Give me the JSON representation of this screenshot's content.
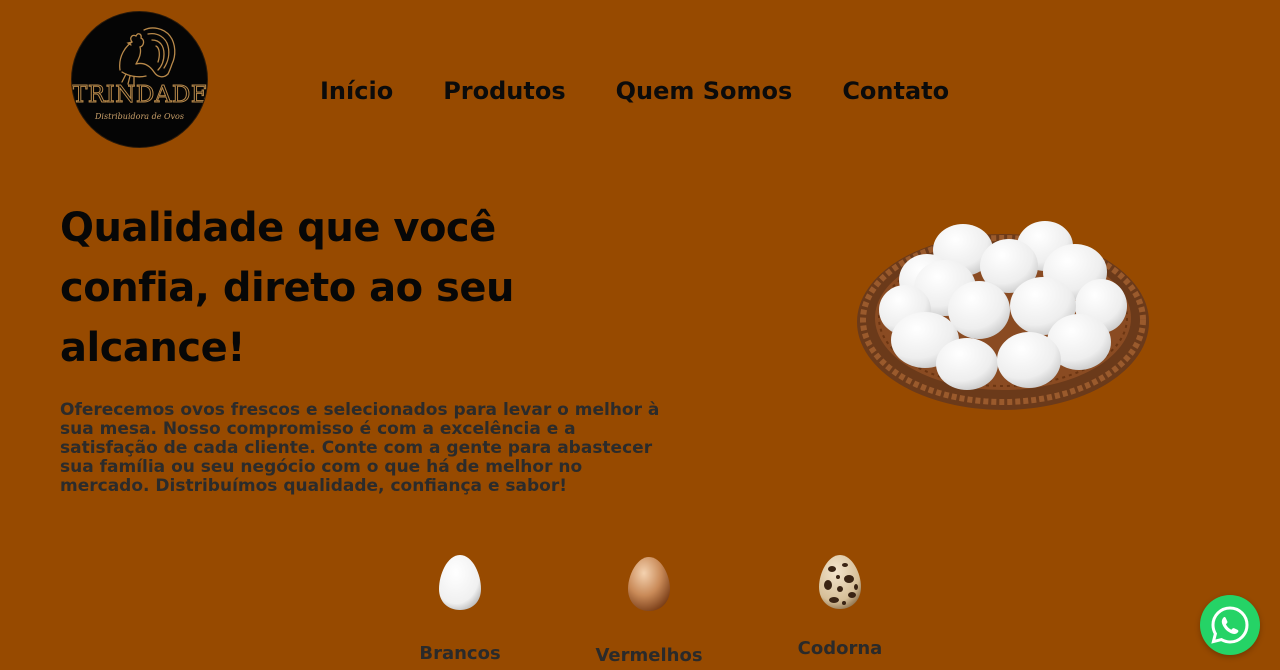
{
  "brand": {
    "name": "TRINDADE",
    "tagline": "Distribuidora de Ovos"
  },
  "nav": {
    "items": [
      {
        "label": "Início"
      },
      {
        "label": "Produtos"
      },
      {
        "label": "Quem Somos"
      },
      {
        "label": "Contato"
      }
    ]
  },
  "hero": {
    "title": "Qualidade que você confia, direto ao seu alcance!",
    "text": "Oferecemos ovos frescos e selecionados para levar o melhor à sua mesa. Nosso compromisso é com a excelência e a satisfação de cada cliente. Conte com a gente para abastecer sua família ou seu negócio com o que há de melhor no mercado. Distribuímos qualidade, confiança e sabor!"
  },
  "products": [
    {
      "label": "Brancos"
    },
    {
      "label": "Vermelhos"
    },
    {
      "label": "Codorna"
    }
  ],
  "colors": {
    "background": "#974a00",
    "whatsapp": "#25d366"
  },
  "icons": {
    "whatsapp": "whatsapp-icon",
    "logo": "rooster-icon"
  }
}
